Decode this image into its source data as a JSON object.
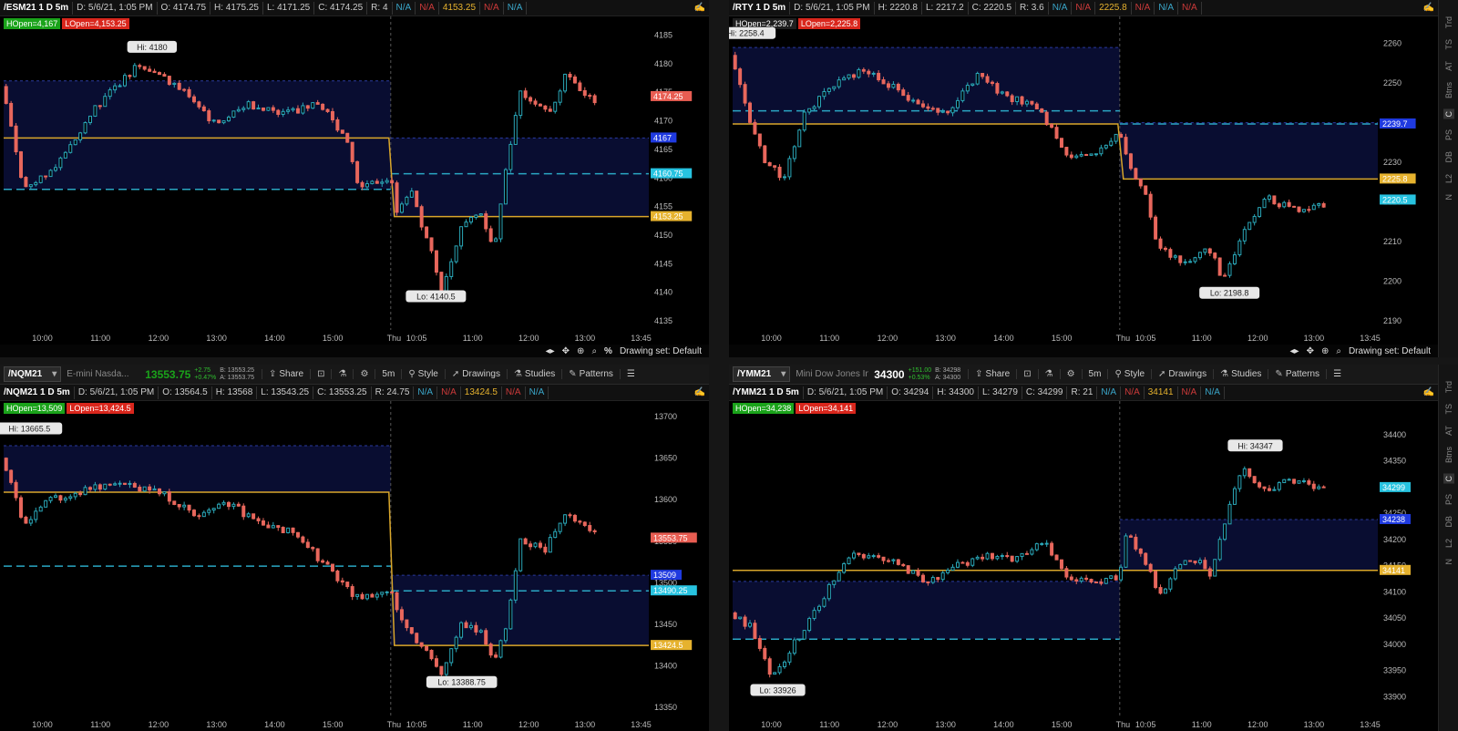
{
  "panels": [
    {
      "header": [
        "/ESM21 1 D 5m",
        "D: 5/6/21, 1:05 PM",
        "O: 4174.75",
        "H: 4175.25",
        "L: 4171.25",
        "C: 4174.25",
        "R: 4"
      ],
      "header_tail": [
        "N/A",
        "N/A",
        "4153.25",
        "N/A",
        "N/A"
      ],
      "badges": [
        {
          "text": "HOpen=4,167",
          "color": "#1aa31a"
        },
        {
          "text": "LOpen=4,153.25",
          "color": "#d9261c"
        }
      ],
      "toolbar": null,
      "footer": {
        "drawing_set": "Drawing set: Default",
        "pct": "%"
      },
      "chart_data": {
        "type": "candlestick",
        "ylim": [
          4135,
          4187
        ],
        "yticks": [
          4135,
          4140,
          4145,
          4150,
          4155,
          4160,
          4165,
          4170,
          4175,
          4180,
          4185
        ],
        "xticks": [
          "10:00",
          "11:00",
          "12:00",
          "13:00",
          "14:00",
          "15:00",
          "Thu",
          "10:05",
          "11:00",
          "12:00",
          "13:00",
          "13:45"
        ],
        "session_break": 0.6,
        "candle_count": 120,
        "path": [
          [
            0,
            4176
          ],
          [
            0.03,
            4158
          ],
          [
            0.08,
            4162
          ],
          [
            0.14,
            4172
          ],
          [
            0.21,
            4180
          ],
          [
            0.28,
            4175
          ],
          [
            0.33,
            4169
          ],
          [
            0.38,
            4173
          ],
          [
            0.43,
            4171
          ],
          [
            0.49,
            4173
          ],
          [
            0.53,
            4167
          ],
          [
            0.55,
            4158
          ],
          [
            0.6,
            4160
          ],
          [
            0.61,
            4154
          ],
          [
            0.63,
            4158
          ],
          [
            0.66,
            4148
          ],
          [
            0.68,
            4140
          ],
          [
            0.71,
            4152
          ],
          [
            0.74,
            4154
          ],
          [
            0.76,
            4147
          ],
          [
            0.78,
            4163
          ],
          [
            0.8,
            4175
          ],
          [
            0.85,
            4172
          ],
          [
            0.87,
            4178
          ],
          [
            0.92,
            4173
          ]
        ],
        "yellow_line": {
          "left": 4167,
          "right": 4153.25
        },
        "box": {
          "day1": [
            4158,
            4177
          ],
          "day2": [
            4153.25,
            4167
          ]
        },
        "cyan_dash": {
          "day1": 4158,
          "day2": 4160.75
        },
        "hi_label": {
          "text": "Hi: 4180",
          "value": 4180,
          "x": 0.23
        },
        "lo_label": {
          "text": "Lo: 4140.5",
          "value": 4140.5,
          "x": 0.67
        },
        "price_labels": [
          {
            "text": "4174.25",
            "value": 4174.25,
            "color": "#e85d52"
          },
          {
            "text": "4167",
            "value": 4167,
            "color": "#1f3ae0"
          },
          {
            "text": "4160.75",
            "value": 4160.75,
            "color": "#27c3e0"
          },
          {
            "text": "4153.25",
            "value": 4153.25,
            "color": "#e6b22e"
          }
        ]
      }
    },
    {
      "header": [
        "/RTY 1 D 5m",
        "D: 5/6/21, 1:05 PM",
        "H: 2220.8",
        "L: 2217.2",
        "C: 2220.5",
        "R: 3.6"
      ],
      "header_tail": [
        "N/A",
        "N/A",
        "2225.8",
        "N/A",
        "N/A",
        "N/A"
      ],
      "badges": [
        {
          "text": "HOpen=2,239.7",
          "color": "#1f1f1f"
        },
        {
          "text": "LOpen=2,225.8",
          "color": "#d9261c"
        }
      ],
      "toolbar": null,
      "footer": {
        "drawing_set": "Drawing set: Default",
        "pct": ""
      },
      "chart_data": {
        "type": "candlestick",
        "ylim": [
          2190,
          2265
        ],
        "yticks": [
          2190,
          2200,
          2210,
          2220,
          2230,
          2240,
          2250,
          2260
        ],
        "xticks": [
          "10:00",
          "11:00",
          "12:00",
          "13:00",
          "14:00",
          "15:00",
          "Thu",
          "10:05",
          "11:00",
          "12:00",
          "13:00",
          "13:45"
        ],
        "session_break": 0.6,
        "candle_count": 120,
        "path": [
          [
            0,
            2257
          ],
          [
            0.02,
            2244
          ],
          [
            0.05,
            2230
          ],
          [
            0.08,
            2226
          ],
          [
            0.11,
            2242
          ],
          [
            0.16,
            2250
          ],
          [
            0.2,
            2253
          ],
          [
            0.24,
            2250
          ],
          [
            0.28,
            2245
          ],
          [
            0.33,
            2242
          ],
          [
            0.38,
            2252
          ],
          [
            0.42,
            2247
          ],
          [
            0.47,
            2244
          ],
          [
            0.52,
            2232
          ],
          [
            0.56,
            2232
          ],
          [
            0.6,
            2237
          ],
          [
            0.62,
            2226
          ],
          [
            0.64,
            2222
          ],
          [
            0.66,
            2208
          ],
          [
            0.7,
            2205
          ],
          [
            0.74,
            2208
          ],
          [
            0.76,
            2200
          ],
          [
            0.8,
            2215
          ],
          [
            0.83,
            2221
          ],
          [
            0.87,
            2218
          ],
          [
            0.92,
            2219
          ]
        ],
        "yellow_line": {
          "left": 2239.7,
          "right": 2225.8
        },
        "box": {
          "day1": [
            2239.7,
            2259
          ],
          "day2": [
            2225.8,
            2240
          ]
        },
        "cyan_dash": {
          "day1": 2243,
          "day2": 2239.7
        },
        "hi_label": {
          "text": "Hi: 2258.4",
          "value": 2258.4,
          "x": 0.02
        },
        "lo_label": {
          "text": "Lo: 2198.8",
          "value": 2198.8,
          "x": 0.77
        },
        "price_labels": [
          {
            "text": "2239.7",
            "value": 2239.7,
            "color": "#1f3ae0"
          },
          {
            "text": "2225.8",
            "value": 2225.8,
            "color": "#e6b22e"
          },
          {
            "text": "2220.5",
            "value": 2220.5,
            "color": "#27c3e0"
          }
        ]
      }
    },
    {
      "header": [
        "/NQM21 1 D 5m",
        "D: 5/6/21, 1:05 PM",
        "O: 13564.5",
        "H: 13568",
        "L: 13543.25",
        "C: 13553.25",
        "R: 24.75"
      ],
      "header_tail": [
        "N/A",
        "N/A",
        "13424.5",
        "N/A",
        "N/A"
      ],
      "badges": [
        {
          "text": "HOpen=13,509",
          "color": "#1aa31a"
        },
        {
          "text": "LOpen=13,424.5",
          "color": "#d9261c"
        }
      ],
      "toolbar": {
        "symbol": "/NQM21",
        "desc": "E-mini Nasda...",
        "last": "13553.75",
        "last_color": "#1aa31a",
        "chg": [
          "+2.75",
          "+0.47%"
        ],
        "ba": [
          "B: 13553.25",
          "A: 13553.75"
        ],
        "share": "Share",
        "tf": "5m",
        "style": "Style",
        "drawings": "Drawings",
        "studies": "Studies",
        "patterns": "Patterns"
      },
      "footer": null,
      "chart_data": {
        "type": "candlestick",
        "ylim": [
          13350,
          13710
        ],
        "yticks": [
          13350,
          13400,
          13450,
          13500,
          13550,
          13600,
          13650,
          13700
        ],
        "xticks": [
          "10:00",
          "11:00",
          "12:00",
          "13:00",
          "14:00",
          "15:00",
          "Thu",
          "10:05",
          "11:00",
          "12:00",
          "13:00",
          "13:45"
        ],
        "session_break": 0.6,
        "candle_count": 120,
        "path": [
          [
            0,
            13650
          ],
          [
            0.03,
            13570
          ],
          [
            0.07,
            13600
          ],
          [
            0.12,
            13610
          ],
          [
            0.18,
            13620
          ],
          [
            0.24,
            13610
          ],
          [
            0.3,
            13580
          ],
          [
            0.35,
            13595
          ],
          [
            0.4,
            13570
          ],
          [
            0.45,
            13560
          ],
          [
            0.5,
            13520
          ],
          [
            0.55,
            13480
          ],
          [
            0.6,
            13490
          ],
          [
            0.62,
            13450
          ],
          [
            0.66,
            13410
          ],
          [
            0.68,
            13390
          ],
          [
            0.71,
            13450
          ],
          [
            0.74,
            13440
          ],
          [
            0.76,
            13400
          ],
          [
            0.78,
            13450
          ],
          [
            0.8,
            13550
          ],
          [
            0.84,
            13540
          ],
          [
            0.87,
            13585
          ],
          [
            0.92,
            13560
          ]
        ],
        "yellow_line": {
          "left": 13609,
          "right": 13424.5
        },
        "box": {
          "day1": [
            13609,
            13665
          ],
          "day2": [
            13424.5,
            13509
          ]
        },
        "cyan_dash": {
          "day1": 13520,
          "day2": 13490.25
        },
        "hi_label": {
          "text": "Hi: 13665.5",
          "value": 13665.5,
          "x": 0.04
        },
        "lo_label": {
          "text": "Lo: 13388.75",
          "value": 13388.75,
          "x": 0.71
        },
        "price_labels": [
          {
            "text": "13553.75",
            "value": 13553.75,
            "color": "#e85d52"
          },
          {
            "text": "13509",
            "value": 13509,
            "color": "#1f3ae0"
          },
          {
            "text": "13490.25",
            "value": 13490.25,
            "color": "#27c3e0"
          },
          {
            "text": "13424.5",
            "value": 13424.5,
            "color": "#e6b22e"
          }
        ]
      }
    },
    {
      "header": [
        "/YMM21 1 D 5m",
        "D: 5/6/21, 1:05 PM",
        "O: 34294",
        "H: 34300",
        "L: 34279",
        "C: 34299",
        "R: 21"
      ],
      "header_tail": [
        "N/A",
        "N/A",
        "34141",
        "N/A",
        "N/A"
      ],
      "badges": [
        {
          "text": "HOpen=34,238",
          "color": "#1aa31a"
        },
        {
          "text": "LOpen=34,141",
          "color": "#d9261c"
        }
      ],
      "toolbar": {
        "symbol": "/YMM21",
        "desc": "Mini Dow Jones In...",
        "last": "34300",
        "last_color": "#ffffff",
        "chg": [
          "+151.00",
          "+0.53%"
        ],
        "ba": [
          "B: 34298",
          "A: 34300"
        ],
        "share": "Share",
        "tf": "5m",
        "style": "Style",
        "drawings": "Drawings",
        "studies": "Studies",
        "patterns": "Patterns"
      },
      "footer": null,
      "chart_data": {
        "type": "candlestick",
        "ylim": [
          33880,
          34450
        ],
        "yticks": [
          33900,
          33950,
          34000,
          34050,
          34100,
          34150,
          34200,
          34250,
          34300,
          34350,
          34400
        ],
        "xticks": [
          "10:00",
          "11:00",
          "12:00",
          "13:00",
          "14:00",
          "15:00",
          "Thu",
          "10:05",
          "11:00",
          "12:00",
          "13:00",
          "13:45"
        ],
        "session_break": 0.6,
        "candle_count": 120,
        "path": [
          [
            0,
            34060
          ],
          [
            0.03,
            34030
          ],
          [
            0.06,
            33935
          ],
          [
            0.09,
            33990
          ],
          [
            0.13,
            34070
          ],
          [
            0.18,
            34170
          ],
          [
            0.22,
            34170
          ],
          [
            0.26,
            34150
          ],
          [
            0.3,
            34120
          ],
          [
            0.35,
            34150
          ],
          [
            0.4,
            34170
          ],
          [
            0.44,
            34160
          ],
          [
            0.48,
            34200
          ],
          [
            0.52,
            34130
          ],
          [
            0.56,
            34120
          ],
          [
            0.6,
            34130
          ],
          [
            0.61,
            34210
          ],
          [
            0.64,
            34160
          ],
          [
            0.66,
            34090
          ],
          [
            0.69,
            34150
          ],
          [
            0.72,
            34160
          ],
          [
            0.74,
            34130
          ],
          [
            0.77,
            34270
          ],
          [
            0.79,
            34340
          ],
          [
            0.82,
            34290
          ],
          [
            0.86,
            34310
          ],
          [
            0.92,
            34300
          ]
        ],
        "yellow_line": {
          "left": 34141,
          "right": 34141
        },
        "box": {
          "day1": [
            34010,
            34120
          ],
          "day2": [
            34141,
            34238
          ]
        },
        "cyan_dash": {
          "day1": 34010,
          "day2": 34141
        },
        "hi_label": {
          "text": "Hi: 34347",
          "value": 34347,
          "x": 0.81
        },
        "lo_label": {
          "text": "Lo: 33926",
          "value": 33926,
          "x": 0.07
        },
        "price_labels": [
          {
            "text": "34299",
            "value": 34299,
            "color": "#27c3e0"
          },
          {
            "text": "34238",
            "value": 34238,
            "color": "#1f3ae0"
          },
          {
            "text": "34141",
            "value": 34141,
            "color": "#e6b22e"
          }
        ]
      }
    }
  ],
  "sidebar": [
    "Trd",
    "TS",
    "AT",
    "Btns",
    "C",
    "PS",
    "DB",
    "L2",
    "N"
  ],
  "sidebar_selected": "C"
}
